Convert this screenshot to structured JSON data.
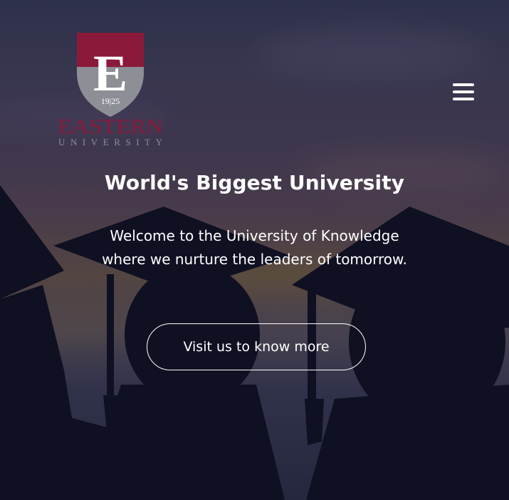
{
  "logo": {
    "letter": "E",
    "year": "19|25",
    "name": "EASTERN",
    "sub": "UNIVERSITY",
    "shield_color": "#8b1a3a",
    "text_color": "#8b1a3a"
  },
  "nav": {
    "menu_icon": "hamburger-icon"
  },
  "hero": {
    "title": "World's Biggest University",
    "subtitle_line1": "Welcome to the University of Knowledge",
    "subtitle_line2": "where we nurture the leaders of tomorrow.",
    "cta_label": "Visit us to know more"
  }
}
